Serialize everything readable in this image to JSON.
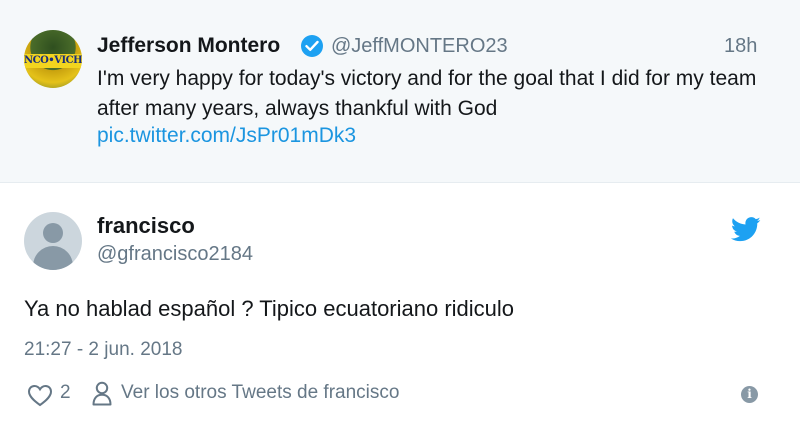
{
  "quoted_tweet": {
    "avatar_text": "NCO•VICHI",
    "display_name": "Jefferson Montero",
    "handle": "@JeffMONTERO23",
    "time": "18h",
    "text": "I'm very happy for today's victory and for the goal that I did for my team after many years, always thankful with God",
    "link": "pic.twitter.com/JsPr01mDk3"
  },
  "tweet": {
    "display_name": "francisco",
    "handle": "@gfrancisco2184",
    "text": "Ya no hablad español ? Tipico ecuatoriano ridiculo",
    "timestamp": "21:27 - 2 jun. 2018",
    "like_count": "2",
    "other_tweets_label": "Ver los otros Tweets de francisco"
  },
  "colors": {
    "accent": "#1da1f2",
    "link": "#1b95e0",
    "muted": "#657786",
    "quoted_bg": "#f5f8fa"
  },
  "icons": [
    "verified-badge-icon",
    "twitter-bird-icon",
    "heart-icon",
    "person-icon",
    "info-icon"
  ]
}
